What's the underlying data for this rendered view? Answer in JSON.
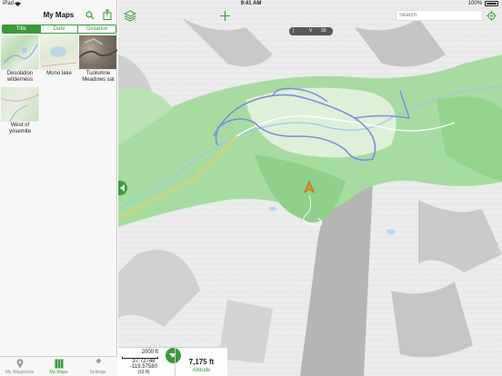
{
  "status_bar": {
    "device": "iPad",
    "time": "9:41 AM",
    "battery": "100%"
  },
  "sidebar": {
    "title": "My Maps",
    "segments": [
      {
        "label": "Title",
        "active": true
      },
      {
        "label": "Date",
        "active": false
      },
      {
        "label": "Distance",
        "active": false
      }
    ],
    "maps": [
      {
        "name": "Desolation wilderness",
        "thumb_color": "#cfe4c9"
      },
      {
        "name": "Mono lake",
        "thumb_color": "#e6ecd8"
      },
      {
        "name": "Tuolumne Meadows sat",
        "thumb_color": "#8a8276"
      },
      {
        "name": "West of yosemite",
        "thumb_color": "#d8e6cd"
      }
    ],
    "tabs": [
      {
        "label": "My Waypoints",
        "icon": "pin-icon",
        "active": false
      },
      {
        "label": "My Maps",
        "icon": "map-icon",
        "active": true
      },
      {
        "label": "Settings",
        "icon": "wrench-icon",
        "active": false
      }
    ]
  },
  "map": {
    "search_placeholder": "Search",
    "scale_pill": {
      "label": "| ",
      "value": "V",
      "num": "30"
    },
    "scale_bar_label": "2000 ft",
    "latitude": "37.72748",
    "longitude": "-119.57580",
    "accuracy": "(±3 ft)",
    "altitude_value": "7,175 ft",
    "altitude_label": "Altitude"
  },
  "colors": {
    "accent": "#3a9a3a",
    "route": "#7a8de0",
    "forest": "#9fd89a",
    "terrain": "#e8e8e8"
  }
}
